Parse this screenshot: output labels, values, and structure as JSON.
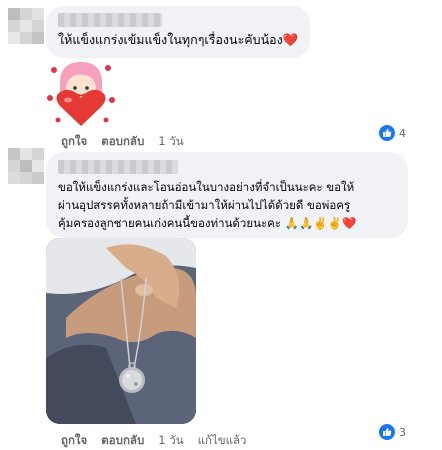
{
  "comments": [
    {
      "text": "ให้แข็งแกร่งเข้มแข็งในทุกๆเรื่องนะคับน้อง",
      "emoji": "❤️",
      "sticker": "girl-heart-sticker",
      "actions": {
        "like": "ถูกใจ",
        "reply": "ตอบกลับ",
        "time": "1 วัน"
      },
      "reaction_count": "4"
    },
    {
      "lines": [
        "ขอให้แข็งแกร่งและโอนอ่อนในบางอย่างที่จำเป็นนะคะ ขอให้",
        "ผ่านอุปสรรคทั้งหลายถ้ามีเข้ามาให้ผ่านไปได้ด้วยดี ขอพ่อครู",
        "คุ้มครองลูกชายคนเก่งคนนี้ของท่านด้วยนะคะ"
      ],
      "emojis": "🙏🙏✌️✌️❤️",
      "photo": "hand-holding-silver-pendant",
      "actions": {
        "like": "ถูกใจ",
        "reply": "ตอบกลับ",
        "time": "1 วัน",
        "edited": "แก้ไขแล้ว"
      },
      "reaction_count": "3"
    }
  ],
  "colors": {
    "like_blue": "#1877f2",
    "bubble": "#f0f2f5",
    "meta": "#65676b"
  }
}
